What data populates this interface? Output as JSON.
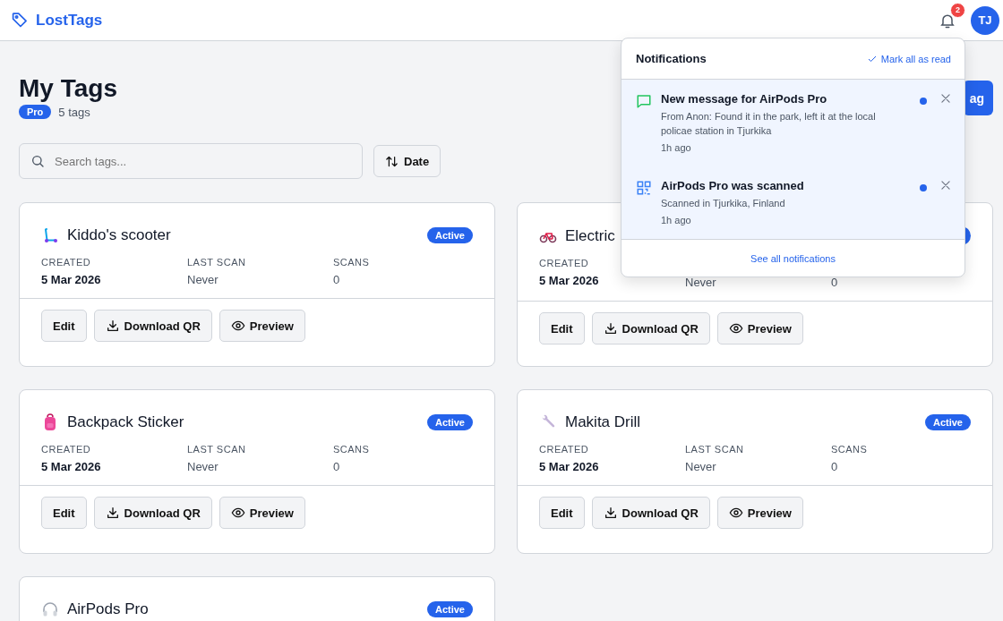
{
  "app": {
    "name": "LostTags"
  },
  "header": {
    "notification_count": "2",
    "avatar_initials": "TJ"
  },
  "page": {
    "title": "My Tags",
    "plan": "Pro",
    "count": "5 tags",
    "new_button": "ag"
  },
  "search": {
    "placeholder": "Search tags..."
  },
  "sort_button": "Date",
  "tags": [
    {
      "name": "Kiddo's scooter",
      "status": "Active",
      "stats": [
        {
          "label": "CREATED",
          "value": "5 Mar 2026",
          "kind": "date"
        },
        {
          "label": "LAST SCAN",
          "value": "Never",
          "kind": "plain"
        },
        {
          "label": "SCANS",
          "value": "0",
          "kind": "plain"
        }
      ],
      "actions": [
        "Edit",
        "Download QR",
        "Preview"
      ]
    },
    {
      "name": "Electric",
      "stats": [
        {
          "label": "CREATED",
          "value": "5 Mar 2026",
          "kind": "date"
        },
        {
          "value": "Never",
          "kind": "plain"
        },
        {
          "value": "0",
          "kind": "plain"
        }
      ],
      "actions": [
        "Edit",
        "Download QR",
        "Preview"
      ]
    },
    {
      "name": "Backpack Sticker",
      "status": "Active",
      "stats": [
        {
          "label": "CREATED",
          "value": "5 Mar 2026",
          "kind": "date"
        },
        {
          "label": "LAST SCAN",
          "value": "Never",
          "kind": "plain"
        },
        {
          "label": "SCANS",
          "value": "0",
          "kind": "plain"
        }
      ],
      "actions": [
        "Edit",
        "Download QR",
        "Preview"
      ]
    },
    {
      "name": "Makita Drill",
      "status": "Active",
      "stats": [
        {
          "label": "CREATED",
          "value": "5 Mar 2026",
          "kind": "date"
        },
        {
          "label": "LAST SCAN",
          "value": "Never",
          "kind": "plain"
        },
        {
          "label": "SCANS",
          "value": "0",
          "kind": "plain"
        }
      ],
      "actions": [
        "Edit",
        "Download QR",
        "Preview"
      ]
    },
    {
      "name": "AirPods Pro",
      "status": "Active"
    }
  ],
  "notifications": {
    "title": "Notifications",
    "mark_all": "Mark all as read",
    "footer": "See all notifications",
    "items": [
      {
        "kind": "message",
        "title": "New message for AirPods Pro",
        "body": "From Anon: Found it in the park, left it at the local policae station in Tjurkika",
        "time": "1h ago",
        "unread": true
      },
      {
        "kind": "scan",
        "title": "AirPods Pro was scanned",
        "body": "Scanned in Tjurkika, Finland",
        "time": "1h ago",
        "unread": true
      }
    ]
  }
}
